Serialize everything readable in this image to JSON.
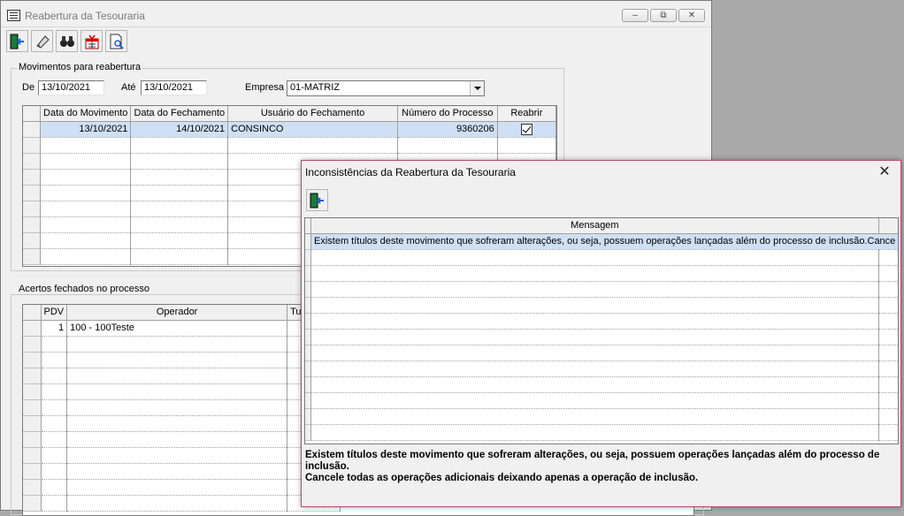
{
  "window": {
    "title": "Reabertura da Tesouraria",
    "minimize_glyph": "–",
    "restore_glyph": "⧉",
    "close_glyph": "✕"
  },
  "toolbar": {
    "icons": [
      "exit-door-icon",
      "eraser-icon",
      "binoculars-icon",
      "gift-calendar-icon",
      "document-search-icon"
    ]
  },
  "movimentos": {
    "group_label": "Movimentos para reabertura",
    "de_label": "De",
    "de_value": "13/10/2021",
    "ate_label": "Até",
    "ate_value": "13/10/2021",
    "empresa_label": "Empresa",
    "empresa_value": "01-MATRIZ",
    "columns": [
      "Data do Movimento",
      "Data do Fechamento",
      "Usuário do Fechamento",
      "Número do Processo",
      "Reabrir"
    ],
    "rows": [
      {
        "data_movimento": "13/10/2021",
        "data_fechamento": "14/10/2021",
        "usuario": "CONSINCO",
        "numero": "9360206",
        "reabrir": true
      }
    ]
  },
  "acertos": {
    "group_label": "Acertos fechados no processo",
    "columns": [
      "PDV",
      "Operador",
      "Tu"
    ],
    "rows": [
      {
        "pdv": "1",
        "operador": "100 - 100Teste",
        "turno": ""
      }
    ]
  },
  "dialog": {
    "title": "Inconsistências da Reabertura da Tesouraria",
    "close_glyph": "✕",
    "column": "Mensagem",
    "rows": [
      "Existem títulos deste movimento que sofreram alterações, ou seja, possuem operações lançadas além do processo de inclusão.Cance"
    ],
    "message_line1": "Existem títulos deste movimento que sofreram alterações, ou seja, possuem operações lançadas além do processo de inclusão.",
    "message_line2": "Cancele todas as operações adicionais deixando apenas a operação de inclusão."
  },
  "colors": {
    "selected_row": "#cfe0f5",
    "dialog_border": "#c0447a",
    "window_bg": "#f0f0f0"
  }
}
